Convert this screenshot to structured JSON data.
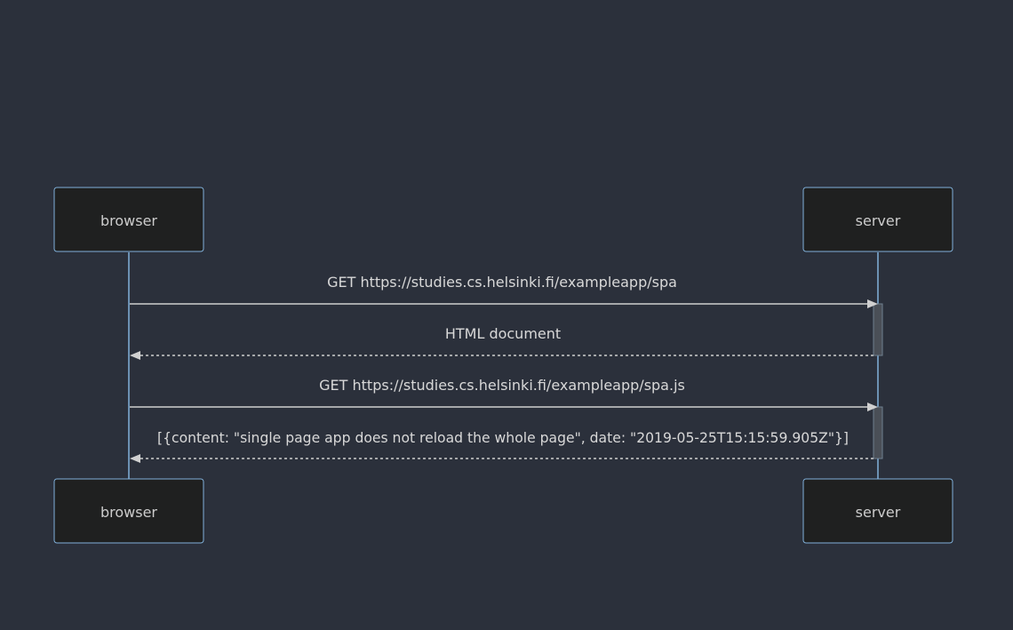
{
  "actors": [
    {
      "id": "browser",
      "label": "browser"
    },
    {
      "id": "server",
      "label": "server"
    }
  ],
  "messages": [
    {
      "from": "browser",
      "to": "server",
      "text": "GET https://studies.cs.helsinki.fi/exampleapp/spa",
      "style": "solid"
    },
    {
      "from": "server",
      "to": "browser",
      "text": "HTML document",
      "style": "dashed"
    },
    {
      "from": "browser",
      "to": "server",
      "text": "GET https://studies.cs.helsinki.fi/exampleapp/spa.js",
      "style": "solid"
    },
    {
      "from": "server",
      "to": "browser",
      "text": "[{content: \"single page app does not reload the whole page\", date: \"2019-05-25T15:15:59.905Z\"}]",
      "style": "dashed"
    }
  ],
  "colors": {
    "background": "#2b303b",
    "actor_fill": "#1f2020",
    "actor_border": "#81b1db",
    "lifeline": "#81b1db",
    "message_line": "#d0d0d0",
    "text": "#cccccc"
  }
}
